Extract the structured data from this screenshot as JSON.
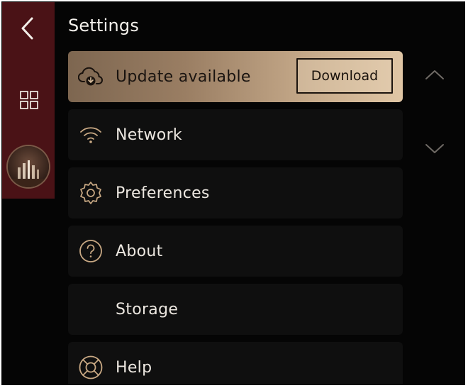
{
  "header": {
    "title": "Settings",
    "back_icon": "chevron-left-icon",
    "apps_icon": "grid-icon"
  },
  "colors": {
    "rail": "#4a1216",
    "background": "#050505",
    "row": "#0f0f0f",
    "accent": "#c9a984",
    "update_gradient_start": "#7d6650",
    "update_gradient_end": "#e0c6a5"
  },
  "settings": {
    "update": {
      "label": "Update available",
      "icon": "cloud-download-icon",
      "action_label": "Download"
    },
    "items": [
      {
        "label": "Network",
        "icon": "wifi-icon"
      },
      {
        "label": "Preferences",
        "icon": "gear-icon"
      },
      {
        "label": "About",
        "icon": "question-circle-icon"
      },
      {
        "label": "Storage",
        "icon": ""
      },
      {
        "label": "Help",
        "icon": "lifebuoy-icon"
      }
    ]
  },
  "scroll": {
    "up_icon": "chevron-up-icon",
    "down_icon": "chevron-down-icon"
  }
}
